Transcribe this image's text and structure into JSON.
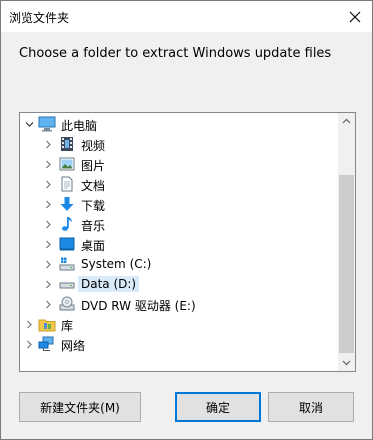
{
  "window": {
    "title": "浏览文件夹",
    "instruction": "Choose a folder to extract Windows update files"
  },
  "tree": {
    "root": {
      "label": "此电脑",
      "icon": "monitor-icon",
      "expanded": true
    },
    "children": [
      {
        "label": "视频",
        "icon": "film-icon"
      },
      {
        "label": "图片",
        "icon": "picture-icon"
      },
      {
        "label": "文档",
        "icon": "document-icon"
      },
      {
        "label": "下载",
        "icon": "download-arrow-icon"
      },
      {
        "label": "音乐",
        "icon": "music-note-icon"
      },
      {
        "label": "桌面",
        "icon": "desktop-icon"
      },
      {
        "label": "System (C:)",
        "icon": "system-drive-icon"
      },
      {
        "label": "Data (D:)",
        "icon": "drive-icon",
        "selected": true
      },
      {
        "label": "DVD RW 驱动器 (E:)",
        "icon": "dvd-drive-icon"
      }
    ],
    "siblings": [
      {
        "label": "库",
        "icon": "library-icon"
      },
      {
        "label": "网络",
        "icon": "network-icon"
      }
    ]
  },
  "buttons": {
    "new_folder": "新建文件夹(M)",
    "ok": "确定",
    "cancel": "取消"
  },
  "colors": {
    "selection": "#d9ebfa",
    "default_button_border": "#0078d7",
    "folder_yellow": "#f3c74b",
    "icon_blue": "#1e88e5"
  }
}
